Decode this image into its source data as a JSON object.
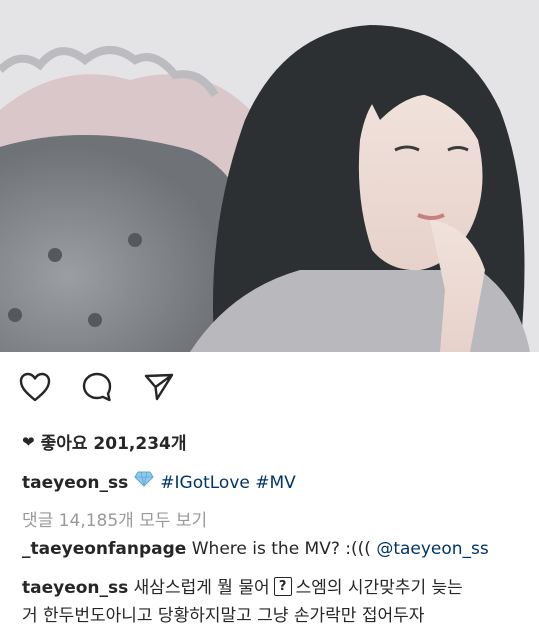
{
  "post": {
    "photo_alt": "Portrait photo"
  },
  "actions": {
    "like_icon": "heart-outline-icon",
    "comment_icon": "comment-bubble-icon",
    "share_icon": "paper-plane-icon"
  },
  "likes": {
    "label": "좋아요 201,234개"
  },
  "caption": {
    "username": "taeyeon_ss",
    "emoji": "gem-icon",
    "hashtag1": "#IGotLove",
    "hashtag2": "#MV"
  },
  "comments": {
    "view_all": "댓글 14,185개 모두 보기",
    "items": [
      {
        "username": "_taeyeonfanpage",
        "text": "Where is the MV? :(((",
        "mention": "@taeyeon_ss"
      },
      {
        "username": "taeyeon_ss",
        "text_part1": "새삼스럽게 뭘 물어",
        "box_char": "?",
        "text_part2": "스엠의 시간맞추기 늦는",
        "text_line2": "거 한두번도아니고 당황하지말고 그냥 손가락만 접어두자"
      }
    ]
  },
  "colors": {
    "text": "#262626",
    "link": "#003569",
    "muted": "#999999"
  }
}
